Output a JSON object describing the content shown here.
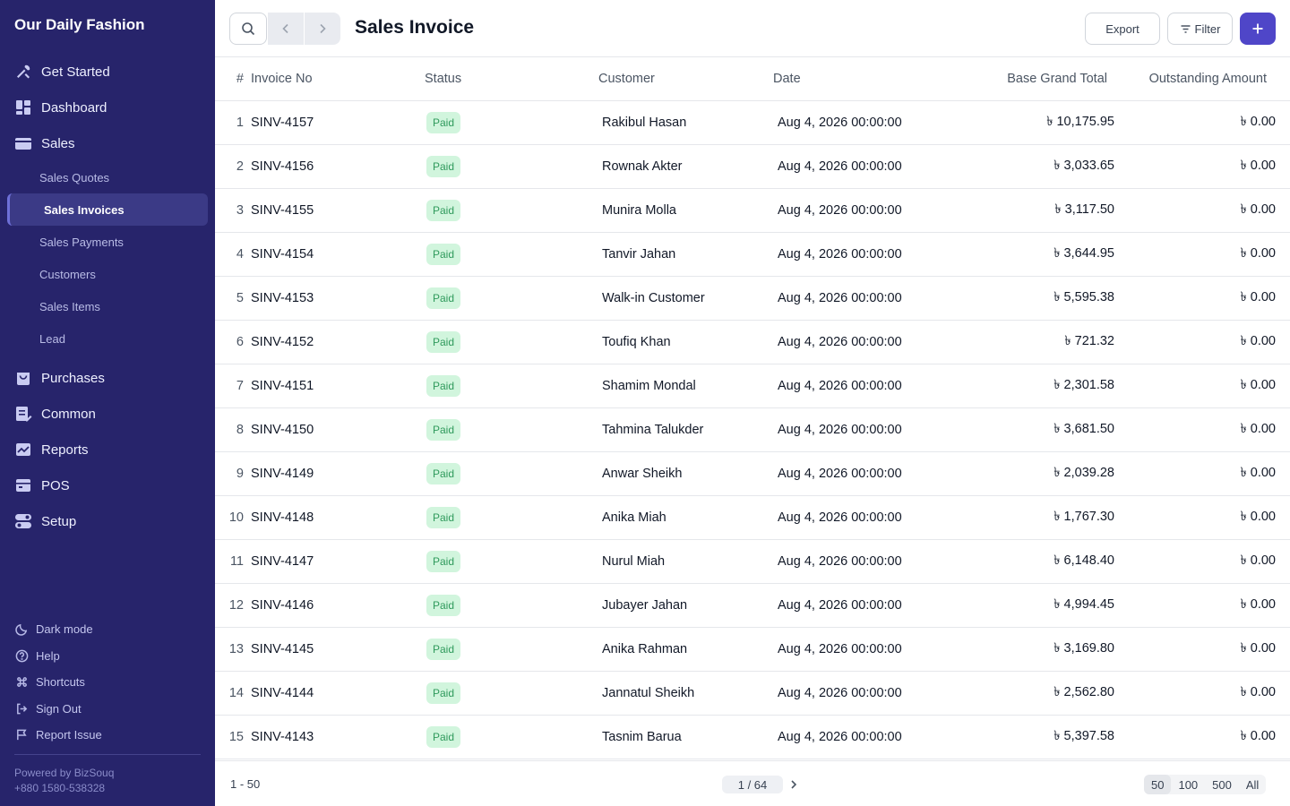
{
  "app": {
    "brand": "Our Daily Fashion"
  },
  "sidebar": {
    "items": [
      {
        "label": "Get Started",
        "icon": "tools-icon"
      },
      {
        "label": "Dashboard",
        "icon": "dashboard-icon"
      },
      {
        "label": "Sales",
        "icon": "wallet-icon"
      }
    ],
    "sales_sub": [
      {
        "label": "Sales Quotes",
        "active": false
      },
      {
        "label": "Sales Invoices",
        "active": true
      },
      {
        "label": "Sales Payments",
        "active": false
      },
      {
        "label": "Customers",
        "active": false
      },
      {
        "label": "Sales Items",
        "active": false
      },
      {
        "label": "Lead",
        "active": false
      }
    ],
    "items2": [
      {
        "label": "Purchases",
        "icon": "bag-icon"
      },
      {
        "label": "Common",
        "icon": "list-edit-icon"
      },
      {
        "label": "Reports",
        "icon": "chart-icon"
      },
      {
        "label": "POS",
        "icon": "register-icon"
      },
      {
        "label": "Setup",
        "icon": "toggle-icon"
      }
    ],
    "bottom": [
      {
        "label": "Dark mode",
        "icon": "moon-icon"
      },
      {
        "label": "Help",
        "icon": "help-icon"
      },
      {
        "label": "Shortcuts",
        "icon": "command-icon"
      },
      {
        "label": "Sign Out",
        "icon": "sign-out-icon"
      },
      {
        "label": "Report Issue",
        "icon": "flag-icon"
      }
    ],
    "powered_by": "Powered by BizSouq",
    "phone": "+880 1580-538328"
  },
  "header": {
    "title": "Sales Invoice",
    "export_label": "Export",
    "filter_label": "Filter"
  },
  "table": {
    "columns": [
      "#",
      "Invoice No",
      "Status",
      "Customer",
      "Date",
      "Base Grand Total",
      "Outstanding Amount"
    ],
    "rows": [
      [
        "1",
        "SINV-4157",
        "Paid",
        "Rakibul Hasan",
        "Aug 4, 2026 00:00:00",
        "৳ 10,175.95",
        "৳ 0.00"
      ],
      [
        "2",
        "SINV-4156",
        "Paid",
        "Rownak Akter",
        "Aug 4, 2026 00:00:00",
        "৳ 3,033.65",
        "৳ 0.00"
      ],
      [
        "3",
        "SINV-4155",
        "Paid",
        "Munira Molla",
        "Aug 4, 2026 00:00:00",
        "৳ 3,117.50",
        "৳ 0.00"
      ],
      [
        "4",
        "SINV-4154",
        "Paid",
        "Tanvir Jahan",
        "Aug 4, 2026 00:00:00",
        "৳ 3,644.95",
        "৳ 0.00"
      ],
      [
        "5",
        "SINV-4153",
        "Paid",
        "Walk-in Customer",
        "Aug 4, 2026 00:00:00",
        "৳ 5,595.38",
        "৳ 0.00"
      ],
      [
        "6",
        "SINV-4152",
        "Paid",
        "Toufiq Khan",
        "Aug 4, 2026 00:00:00",
        "৳ 721.32",
        "৳ 0.00"
      ],
      [
        "7",
        "SINV-4151",
        "Paid",
        "Shamim Mondal",
        "Aug 4, 2026 00:00:00",
        "৳ 2,301.58",
        "৳ 0.00"
      ],
      [
        "8",
        "SINV-4150",
        "Paid",
        "Tahmina Talukder",
        "Aug 4, 2026 00:00:00",
        "৳ 3,681.50",
        "৳ 0.00"
      ],
      [
        "9",
        "SINV-4149",
        "Paid",
        "Anwar Sheikh",
        "Aug 4, 2026 00:00:00",
        "৳ 2,039.28",
        "৳ 0.00"
      ],
      [
        "10",
        "SINV-4148",
        "Paid",
        "Anika Miah",
        "Aug 4, 2026 00:00:00",
        "৳ 1,767.30",
        "৳ 0.00"
      ],
      [
        "11",
        "SINV-4147",
        "Paid",
        "Nurul Miah",
        "Aug 4, 2026 00:00:00",
        "৳ 6,148.40",
        "৳ 0.00"
      ],
      [
        "12",
        "SINV-4146",
        "Paid",
        "Jubayer Jahan",
        "Aug 4, 2026 00:00:00",
        "৳ 4,994.45",
        "৳ 0.00"
      ],
      [
        "13",
        "SINV-4145",
        "Paid",
        "Anika Rahman",
        "Aug 4, 2026 00:00:00",
        "৳ 3,169.80",
        "৳ 0.00"
      ],
      [
        "14",
        "SINV-4144",
        "Paid",
        "Jannatul Sheikh",
        "Aug 4, 2026 00:00:00",
        "৳ 2,562.80",
        "৳ 0.00"
      ],
      [
        "15",
        "SINV-4143",
        "Paid",
        "Tasnim Barua",
        "Aug 4, 2026 00:00:00",
        "৳ 5,397.58",
        "৳ 0.00"
      ]
    ]
  },
  "footer": {
    "range": "1 - 50",
    "page": "1 / 64",
    "sizes": [
      "50",
      "100",
      "500",
      "All"
    ],
    "selected_size": "50"
  },
  "colors": {
    "sidebar_bg": "#27246b",
    "accent": "#4f46c8",
    "paid_badge_bg": "#d1f5dd",
    "paid_badge_text": "#2f9a5c"
  }
}
